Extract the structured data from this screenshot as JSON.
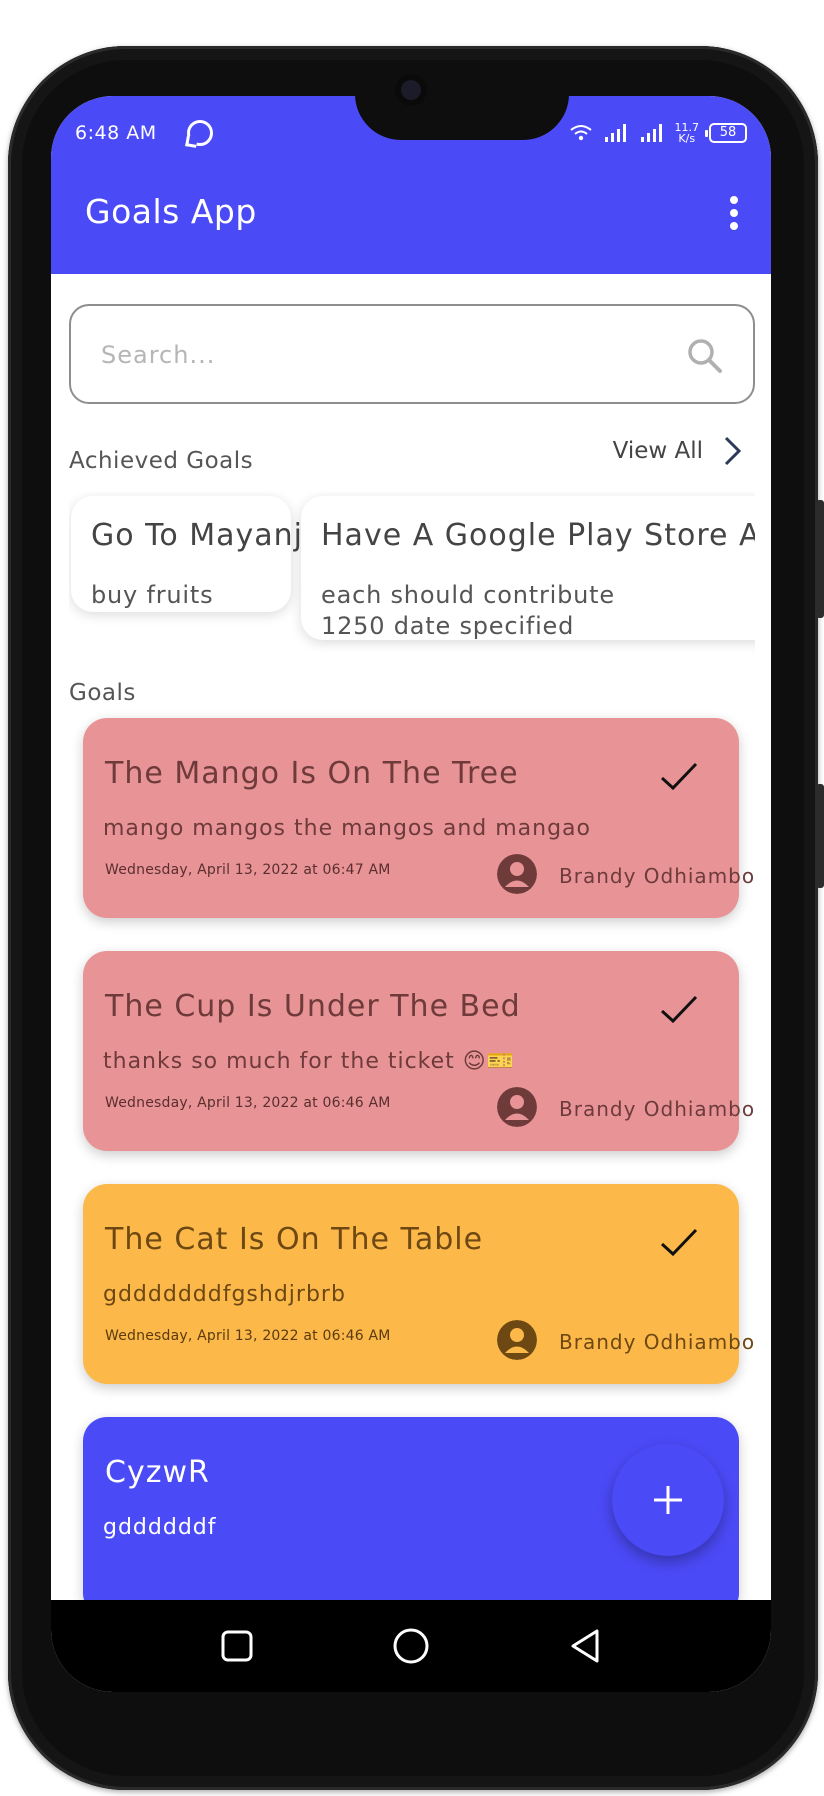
{
  "status_bar": {
    "time": "6:48 AM",
    "net_speed_top": "11.7",
    "net_speed_bottom": "K/s",
    "battery": "58",
    "icons": [
      "whatsapp-icon",
      "wifi-icon",
      "signal-icon",
      "signal-icon",
      "battery-icon"
    ]
  },
  "app_bar": {
    "title": "Goals App",
    "menu_icon": "more-vert-icon"
  },
  "search": {
    "placeholder": "Search...",
    "value": "",
    "icon": "search-icon"
  },
  "achieved": {
    "label": "Achieved Goals",
    "view_all": "View All",
    "cards": [
      {
        "title": "Go To Mayanja",
        "description": "buy fruits"
      },
      {
        "title": "Have A Google Play Store Ac",
        "description": "each should contribute 1250 date specified"
      }
    ]
  },
  "goals": {
    "label": "Goals",
    "items": [
      {
        "title": "The Mango Is On The Tree",
        "description": "mango mangos the mangos and mangao",
        "date": "Wednesday, April 13, 2022 at 06:47 AM",
        "author": "Brandy Odhiambo",
        "color": "#e89496",
        "done": true
      },
      {
        "title": "The Cup Is Under The Bed",
        "description": "thanks so much for the ticket 😊🎫",
        "date": "Wednesday, April 13, 2022 at 06:46 AM",
        "author": "Brandy Odhiambo",
        "color": "#e89496",
        "done": true
      },
      {
        "title": "The Cat Is On The Table",
        "description": "gdddddddfgshdjrbrb",
        "date": "Wednesday, April 13, 2022 at 06:46 AM",
        "author": "Brandy Odhiambo",
        "color": "#fcb94a",
        "done": true
      },
      {
        "title": "CyzwR",
        "description": "gddddddf",
        "color": "#4b4af7"
      }
    ]
  },
  "fab": {
    "icon": "plus-icon"
  },
  "nav_bar": {
    "icons": [
      "recents-square-icon",
      "home-circle-icon",
      "back-triangle-icon"
    ]
  },
  "colors": {
    "primary": "#4b4af7",
    "pink_card": "#e89496",
    "orange_card": "#fcb94a"
  }
}
